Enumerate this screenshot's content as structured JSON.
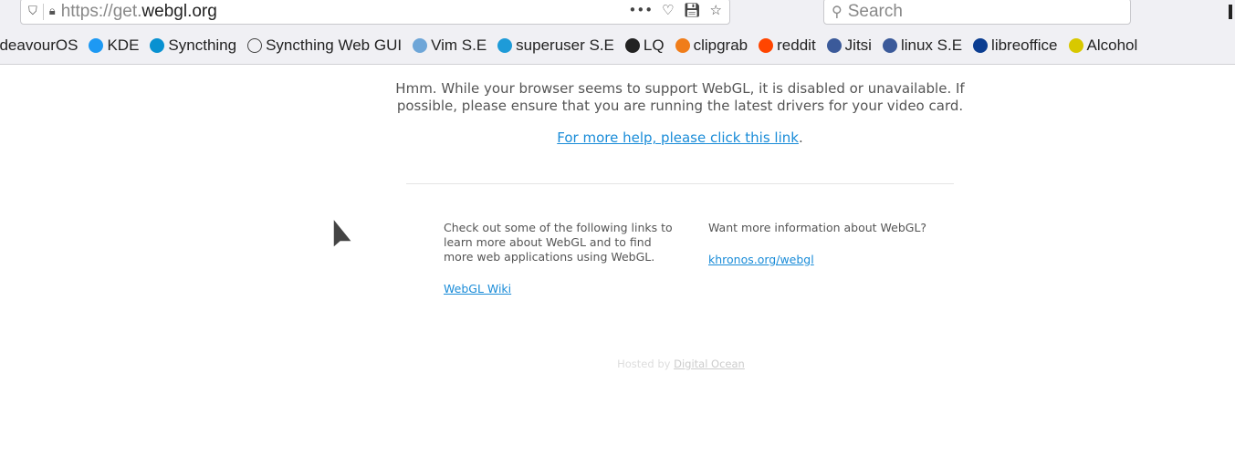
{
  "browser": {
    "url_prefix": "https://get.",
    "url_domain": "webgl.org",
    "search_placeholder": "Search",
    "bookmarks": [
      {
        "label": "ndeavourOS",
        "icon": "endeavouros-icon",
        "color": "#7f3fbf"
      },
      {
        "label": "KDE",
        "icon": "kde-icon",
        "color": "#1d99f3"
      },
      {
        "label": "Syncthing",
        "icon": "syncthing-icon",
        "color": "#0891d1"
      },
      {
        "label": "Syncthing Web GUI",
        "icon": "globe-icon",
        "color": "#444444"
      },
      {
        "label": "Vim S.E",
        "icon": "vim-se-icon",
        "color": "#6ea6d8"
      },
      {
        "label": "superuser S.E",
        "icon": "superuser-icon",
        "color": "#1e9bd8"
      },
      {
        "label": "LQ",
        "icon": "tux-icon",
        "color": "#222222"
      },
      {
        "label": "clipgrab",
        "icon": "clipgrab-icon",
        "color": "#f07d1a"
      },
      {
        "label": "reddit",
        "icon": "reddit-icon",
        "color": "#ff4500"
      },
      {
        "label": "Jitsi",
        "icon": "jitsi-icon",
        "color": "#3b5a9a"
      },
      {
        "label": "linux S.E",
        "icon": "unix-se-icon",
        "color": "#3b5a9a"
      },
      {
        "label": "libreoffice",
        "icon": "question-icon",
        "color": "#0b3d91"
      },
      {
        "label": "Alcohol",
        "icon": "lock-icon",
        "color": "#d8c800"
      }
    ]
  },
  "page": {
    "message": "Hmm. While your browser seems to support WebGL, it is disabled or unavailable. If possible, please ensure that you are running the latest drivers for your video card.",
    "help_link": "For more help, please click this link",
    "help_suffix": ".",
    "left_text": "Check out some of the following links to learn more about WebGL and to find more web applications using WebGL.",
    "left_link": "WebGL Wiki",
    "right_text": "Want more information about WebGL?",
    "right_link": "khronos.org/webgl",
    "footer_prefix": "Hosted by ",
    "footer_link": "Digital Ocean"
  },
  "colors": {
    "link": "#1a8cd8",
    "text": "#555555"
  }
}
